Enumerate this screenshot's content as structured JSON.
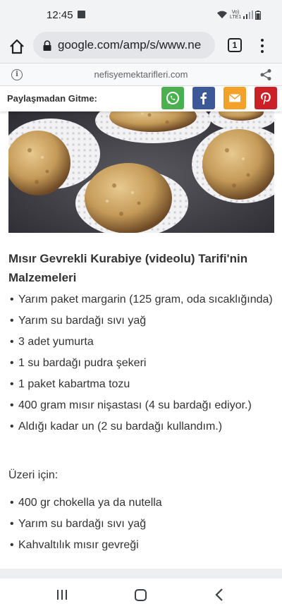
{
  "status_bar": {
    "time": "12:45",
    "network_label": "Vo) LTE1"
  },
  "browser": {
    "url": "google.com/amp/s/www.ne",
    "tab_count": "1"
  },
  "amp_header": {
    "domain": "nefisyemektarifleri.com"
  },
  "share_bar": {
    "label": "Paylaşmadan Gitme:",
    "buttons": [
      {
        "name": "whatsapp",
        "color": "#4caf50"
      },
      {
        "name": "facebook",
        "color": "#3b5998"
      },
      {
        "name": "email",
        "color": "#f4a12b"
      },
      {
        "name": "pinterest",
        "color": "#cb2027"
      }
    ]
  },
  "article": {
    "title": "Mısır Gevrekli Kurabiye (videolu) Tarifi'nin Malzemeleri",
    "ingredients": [
      "Yarım paket margarin (125 gram, oda sıcaklığında)",
      "Yarım su bardağı sıvı yağ",
      "3 adet yumurta",
      "1 su bardağı pudra şekeri",
      "1 paket kabartma tozu",
      "400 gram mısır nişastası (4 su bardağı ediyor.)",
      "Aldığı kadar un (2 su bardağı kullandım.)"
    ],
    "topping_heading": "Üzeri için:",
    "topping_items": [
      "400 gr chokella ya da nutella",
      "Yarım su bardağı sıvı yağ",
      "Kahvaltılık mısır gevreği"
    ]
  }
}
